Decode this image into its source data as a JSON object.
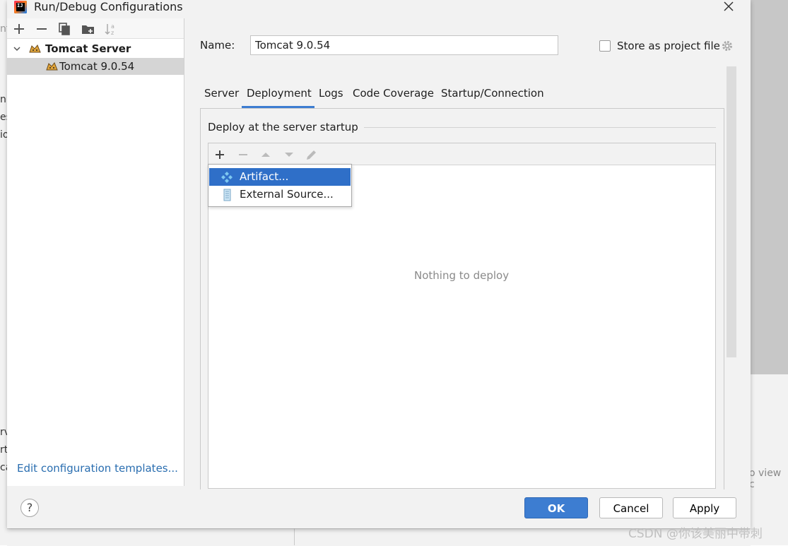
{
  "window": {
    "title": "Run/Debug Configurations"
  },
  "background": {
    "left_fragments": [
      "nt",
      "nl",
      "es",
      "io",
      "rv",
      "rt",
      "ca"
    ],
    "right_fragment": "o view c"
  },
  "left_panel": {
    "tree": {
      "group_label": "Tomcat Server",
      "item_label": "Tomcat 9.0.54"
    },
    "edit_templates_link": "Edit configuration templates..."
  },
  "config": {
    "name_label": "Name:",
    "name_value": "Tomcat 9.0.54",
    "store_as_project_file_label": "Store as project file",
    "store_as_project_file_checked": false
  },
  "tabs": [
    {
      "label": "Server",
      "active": false
    },
    {
      "label": "Deployment",
      "active": true
    },
    {
      "label": "Logs",
      "active": false
    },
    {
      "label": "Code Coverage",
      "active": false
    },
    {
      "label": "Startup/Connection",
      "active": false
    }
  ],
  "deployment": {
    "section_title": "Deploy at the server startup",
    "empty_text": "Nothing to deploy",
    "popup_menu": [
      {
        "label": "Artifact...",
        "selected": true,
        "icon": "artifact-icon"
      },
      {
        "label": "External Source...",
        "selected": false,
        "icon": "external-source-icon"
      }
    ]
  },
  "buttons": {
    "help": "?",
    "ok": "OK",
    "cancel": "Cancel",
    "apply": "Apply"
  },
  "watermark": "CSDN @你该美丽中带刺",
  "colors": {
    "accent": "#3d7dd1",
    "selection": "#2f6fc8",
    "link": "#2a6eb0"
  }
}
